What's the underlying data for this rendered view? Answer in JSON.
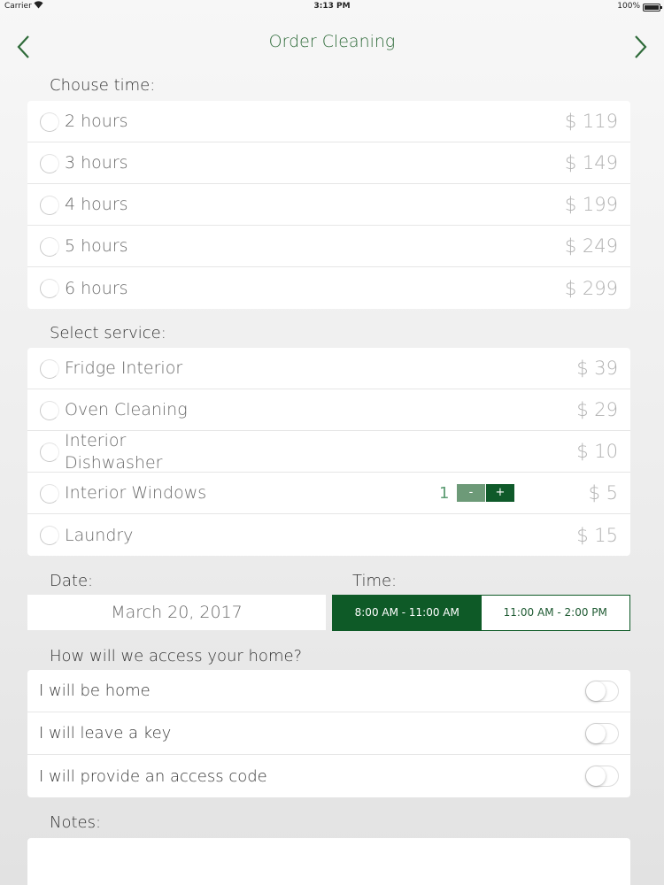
{
  "status_bar": {
    "carrier": "Carrier",
    "time": "3:13 PM",
    "battery": "100%"
  },
  "nav": {
    "title": "Order Cleaning",
    "back_icon": "chevron-left-icon",
    "forward_icon": "chevron-right-icon",
    "accent_color": "#2f6b3a"
  },
  "time_section": {
    "label": "Chouse time:",
    "options": [
      {
        "label": "2 hours",
        "price": "$ 119"
      },
      {
        "label": "3 hours",
        "price": "$ 149"
      },
      {
        "label": "4 hours",
        "price": "$ 199"
      },
      {
        "label": "5 hours",
        "price": "$ 249"
      },
      {
        "label": "6 hours",
        "price": "$ 299"
      }
    ]
  },
  "service_section": {
    "label": "Select service:",
    "options": [
      {
        "label": "Fridge Interior",
        "price": "$ 39"
      },
      {
        "label": "Oven Cleaning",
        "price": "$ 29"
      },
      {
        "label_line1": "Interior",
        "label_line2": "Dishwasher",
        "price": "$ 10"
      },
      {
        "label": "Interior Windows",
        "price": "$ 5",
        "quantity": "1",
        "minus": "-",
        "plus": "+"
      },
      {
        "label": "Laundry",
        "price": "$ 15"
      }
    ]
  },
  "schedule": {
    "date_label": "Date:",
    "date_value": "March 20, 2017",
    "time_label": "Time:",
    "slots": [
      {
        "label": "8:00 AM - 11:00 AM",
        "selected": true
      },
      {
        "label": "11:00 AM - 2:00 PM",
        "selected": false
      }
    ],
    "selected_color": "#0e5a27"
  },
  "access_section": {
    "label": "How will we access your home?",
    "options": [
      {
        "label": "I will be home",
        "on": false
      },
      {
        "label": "I will leave a key",
        "on": false
      },
      {
        "label": "I will provide an access code",
        "on": false
      }
    ]
  },
  "notes": {
    "label": "Notes:"
  }
}
